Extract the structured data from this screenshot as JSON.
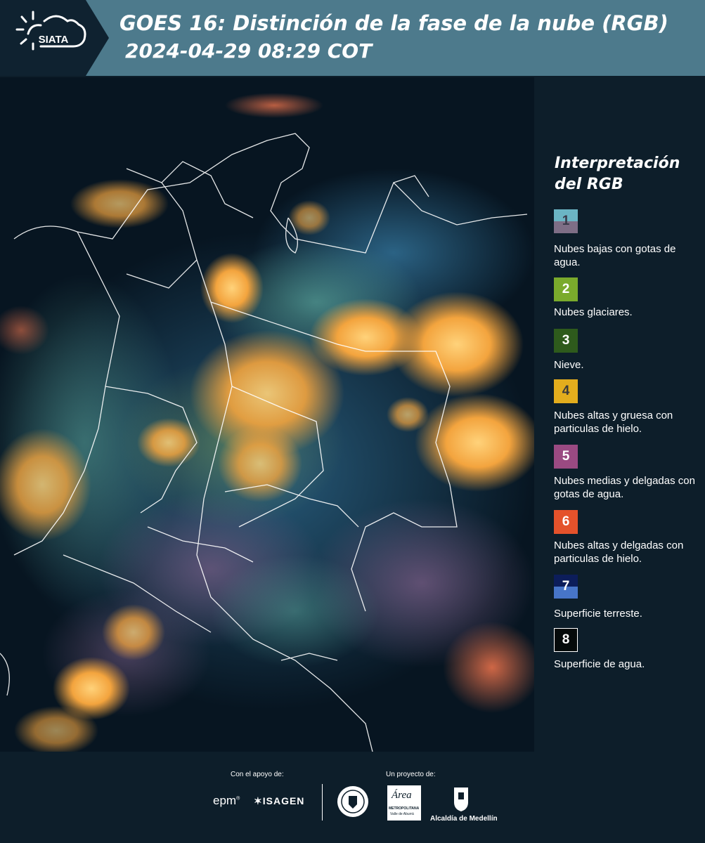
{
  "header": {
    "logo_text": "SIATA",
    "title": "GOES 16: Distinción de la fase de la nube (RGB)",
    "datetime": "2024-04-29 08:29 COT"
  },
  "legend": {
    "title_line1": "Interpretación",
    "title_line2": "del RGB",
    "items": [
      {
        "number": "1",
        "label": "Nubes bajas con gotas de agua.",
        "color_top": "#6bb5c4",
        "color_bottom": "#7e6e86"
      },
      {
        "number": "2",
        "label": "Nubes glaciares.",
        "color": "#7aaa2c"
      },
      {
        "number": "3",
        "label": "Nieve.",
        "color": "#2e5a1c"
      },
      {
        "number": "4",
        "label": "Nubes altas y gruesa con particulas de hielo.",
        "color": "#e3ad1d"
      },
      {
        "number": "5",
        "label": "Nubes medias y delgadas con gotas de agua.",
        "color": "#9a4a82"
      },
      {
        "number": "6",
        "label": "Nubes altas y delgadas con particulas de hielo.",
        "color": "#e4522b"
      },
      {
        "number": "7",
        "label": "Superficie terreste.",
        "color_top": "#0c1d5a",
        "color_bottom": "#4775c8"
      },
      {
        "number": "8",
        "label": "Superficie de agua.",
        "color": "#050a0a"
      }
    ]
  },
  "footer": {
    "support_label": "Con el apoyo de:",
    "project_label": "Un proyecto de:",
    "sponsor_1": "epm",
    "sponsor_2": "ISAGEN",
    "partner_area": "Área",
    "partner_area_sub": "METROPOLITANA",
    "partner_area_sub2": "Valle de Aburrá",
    "partner_alcaldia": "Alcaldía de Medellín"
  }
}
